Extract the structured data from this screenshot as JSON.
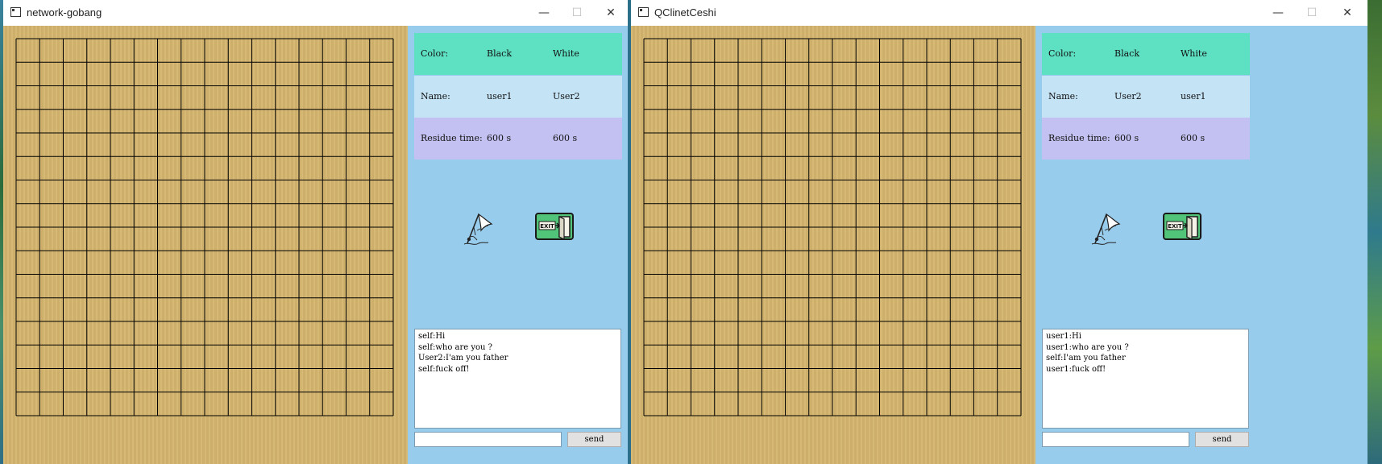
{
  "colors": {
    "board": "#d4b56e",
    "panel": "#98ccec",
    "color_row": "#5ee0c3",
    "name_row": "#c4e3f5",
    "time_row": "#c3c1f1"
  },
  "board": {
    "lines": 17
  },
  "windows": [
    {
      "title": "network-gobang",
      "info": {
        "color_label": "Color:",
        "black_label": "Black",
        "white_label": "White",
        "name_label": "Name:",
        "black_name": "user1",
        "white_name": "User2",
        "time_label": "Residue time:",
        "black_time": "600 s",
        "white_time": "600 s"
      },
      "surrender_icon": "surrender-flag-icon",
      "exit_icon": "exit-sign-icon",
      "exit_text": "EXIT",
      "chat": [
        "self:Hi",
        "self:who are you ?",
        "User2:I'am you father",
        "self:fuck off!"
      ],
      "input_value": "",
      "send_label": "send"
    },
    {
      "title": "QClinetCeshi",
      "info": {
        "color_label": "Color:",
        "black_label": "Black",
        "white_label": "White",
        "name_label": "Name:",
        "black_name": "User2",
        "white_name": "user1",
        "time_label": "Residue time:",
        "black_time": "600 s",
        "white_time": "600 s"
      },
      "surrender_icon": "surrender-flag-icon",
      "exit_icon": "exit-sign-icon",
      "exit_text": "EXIT",
      "chat": [
        "user1:Hi",
        "user1:who are you ?",
        "self:I'am you father",
        "user1:fuck off!"
      ],
      "input_value": "",
      "send_label": "send"
    }
  ],
  "titlebar_buttons": {
    "minimize": "—",
    "maximize": "☐",
    "close": "✕"
  }
}
